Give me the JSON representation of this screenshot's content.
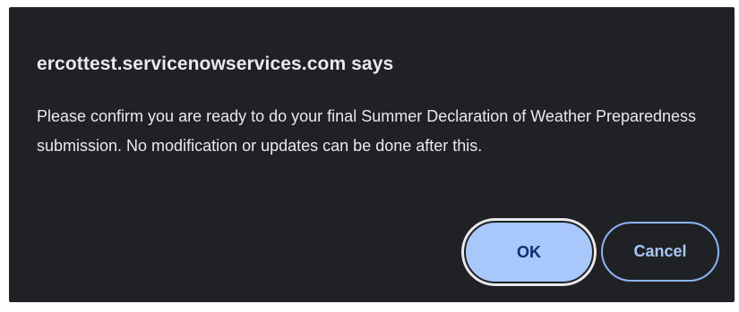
{
  "dialog": {
    "title": "ercottest.servicenowservices.com says",
    "message": "Please confirm you are ready to do your final Summer Declaration of Weather Preparedness submission. No modification or updates can be done after this.",
    "ok_label": "OK",
    "cancel_label": "Cancel"
  },
  "colors": {
    "dialog_background": "#202124",
    "text": "#e8eaed",
    "ok_button_fill": "#a8c7fa",
    "ok_button_text": "#062e6f",
    "cancel_button_text": "#a8c7fa",
    "cancel_button_border": "#8ab4f8",
    "focus_ring": "#e8eaed"
  }
}
